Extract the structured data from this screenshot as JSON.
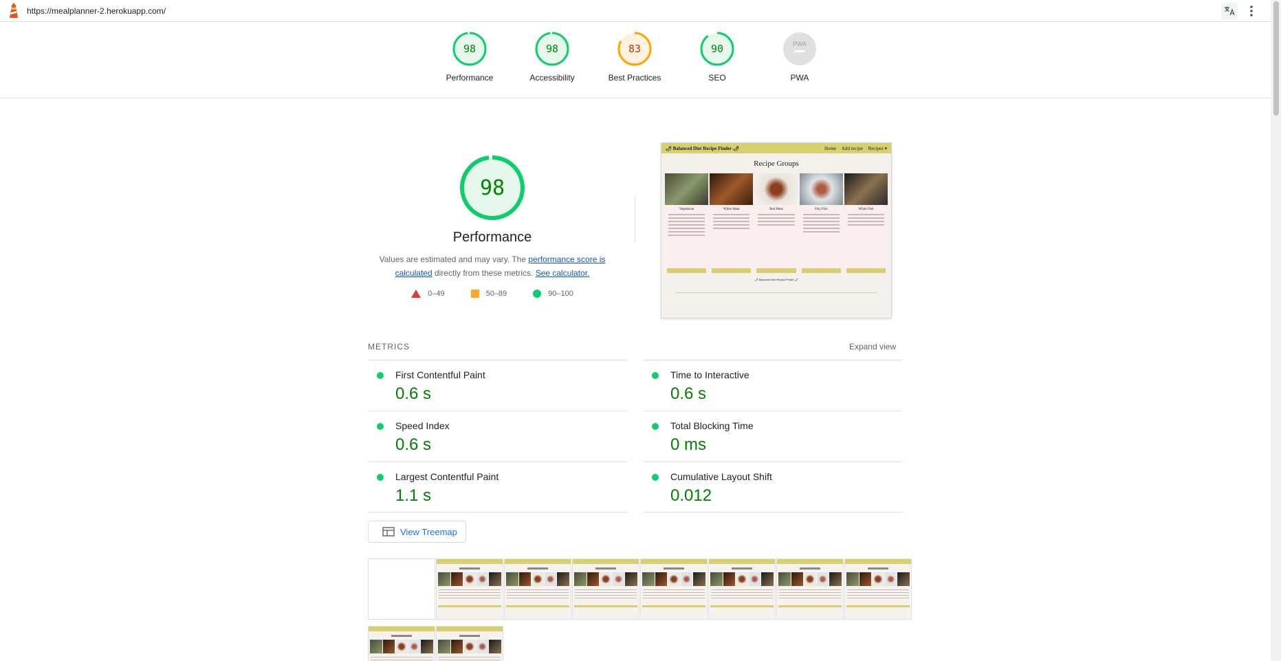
{
  "browser": {
    "url": "https://mealplanner-2.herokuapp.com/"
  },
  "scores": [
    {
      "label": "Performance",
      "value": "98",
      "fraction": 0.98,
      "status": "pass",
      "color": "#0cce6b",
      "text_color": "#008800",
      "fill": "#e6f7ec"
    },
    {
      "label": "Accessibility",
      "value": "98",
      "fraction": 0.98,
      "status": "pass",
      "color": "#0cce6b",
      "text_color": "#008800",
      "fill": "#e6f7ec"
    },
    {
      "label": "Best Practices",
      "value": "83",
      "fraction": 0.83,
      "status": "average",
      "color": "#ffa400",
      "text_color": "#c33300",
      "fill": "#fff3e0"
    },
    {
      "label": "SEO",
      "value": "90",
      "fraction": 0.9,
      "status": "pass",
      "color": "#0cce6b",
      "text_color": "#008800",
      "fill": "#e6f7ec"
    },
    {
      "label": "PWA",
      "value": "PWA",
      "fraction": 0,
      "status": "na",
      "color": "#e0e0e0",
      "text_color": "#9e9e9e",
      "fill": "#e0e0e0"
    }
  ],
  "performance": {
    "score": "98",
    "fraction": 0.98,
    "title": "Performance",
    "desc_prefix": "Values are estimated and may vary. The ",
    "desc_link": "performance score is calculated",
    "desc_middle": " directly from these metrics. ",
    "desc_link2": "See calculator.",
    "legend": [
      {
        "shape": "triangle",
        "range": "0–49",
        "color": "#e53935"
      },
      {
        "shape": "square",
        "range": "50–89",
        "color": "#ffa726"
      },
      {
        "shape": "circle",
        "range": "90–100",
        "color": "#0cce6b"
      }
    ]
  },
  "final_screenshot": {
    "brand": "🌶 Balanced Diet Recipe Finder 🌶",
    "nav_links": [
      "Home",
      "Add recipe",
      "Recipes ▾"
    ],
    "heading": "Recipe Groups",
    "groups": [
      "Vegetarian",
      "White Meat",
      "Red Meat",
      "Oily Fish",
      "White Fish"
    ],
    "footer": "🌶 Balanced Diet Recipe Finder 🌶"
  },
  "metrics": {
    "title": "METRICS",
    "expand_label": "Expand view",
    "items": [
      {
        "name": "First Contentful Paint",
        "value": "0.6 s"
      },
      {
        "name": "Time to Interactive",
        "value": "0.6 s"
      },
      {
        "name": "Speed Index",
        "value": "0.6 s"
      },
      {
        "name": "Total Blocking Time",
        "value": "0 ms"
      },
      {
        "name": "Largest Contentful Paint",
        "value": "1.1 s"
      },
      {
        "name": "Cumulative Layout Shift",
        "value": "0.012"
      }
    ]
  },
  "treemap": {
    "label": "View Treemap",
    "icon": "treemap-icon"
  },
  "filmstrip": {
    "frame_count": 10
  }
}
